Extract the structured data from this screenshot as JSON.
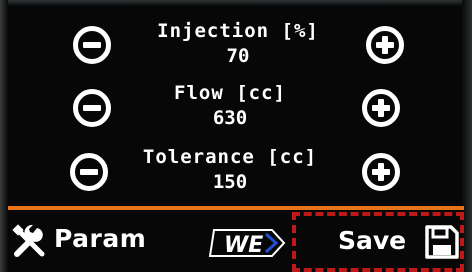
{
  "parameters": [
    {
      "label": "Injection [%]",
      "value": "70",
      "decrease_icon": "minus-circle-icon",
      "increase_icon": "plus-circle-icon"
    },
    {
      "label": "Flow [cc]",
      "value": "630",
      "decrease_icon": "minus-circle-icon",
      "increase_icon": "plus-circle-icon"
    },
    {
      "label": "Tolerance [cc]",
      "value": "150",
      "decrease_icon": "minus-circle-icon",
      "increase_icon": "plus-circle-icon"
    }
  ],
  "footer": {
    "param_label": "Param",
    "param_icon": "tools-icon",
    "brand_logo_text": "WE",
    "save_label": "Save",
    "save_icon": "floppy-disk-icon"
  },
  "colors": {
    "background": "#070707",
    "foreground": "#ffffff",
    "divider": "#e8741a",
    "save_highlight": "#c01818",
    "brand_blue": "#1f4fd0"
  }
}
